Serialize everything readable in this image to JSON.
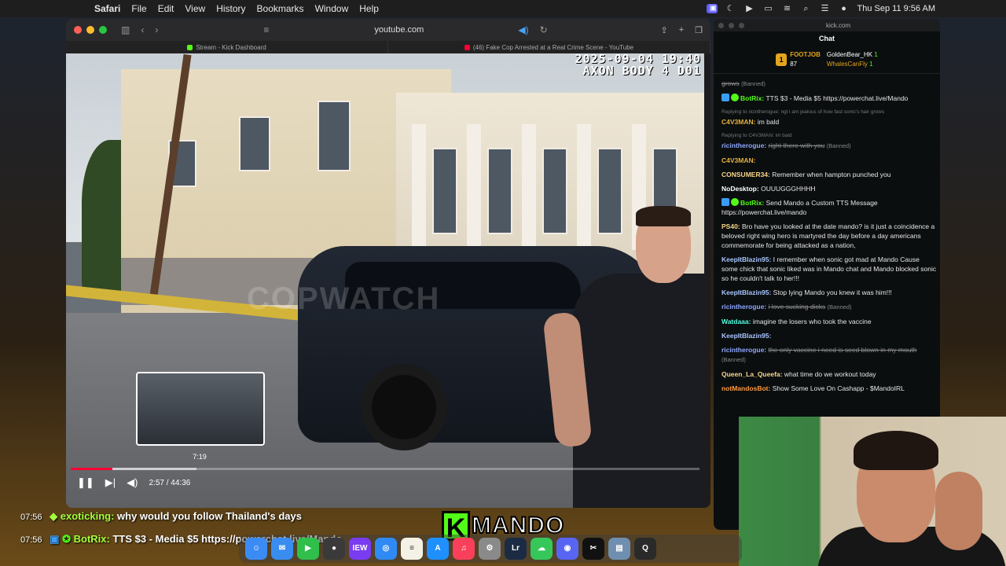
{
  "menubar": {
    "app": "Safari",
    "items": [
      "File",
      "Edit",
      "View",
      "History",
      "Bookmarks",
      "Window",
      "Help"
    ],
    "clock": "Thu Sep 11  9:56 AM"
  },
  "safari": {
    "url": "youtube.com",
    "tabs": [
      {
        "title": "Stream - Kick Dashboard",
        "color": "#53fc18"
      },
      {
        "title": "(46) Fake Cop Arrested at a Real Crime Scene - YouTube",
        "color": "#ff0033"
      }
    ],
    "video": {
      "overlay_line1": "2025-09-04 19:40",
      "overlay_line2": "AXON BODY 4 D01",
      "watermark": "COPWATCH",
      "preview_time": "7:19",
      "time_display": "2:57 / 44:36",
      "progress_fraction": 0.066,
      "loaded_fraction": 0.2
    }
  },
  "kick": {
    "url": "kick.com",
    "title": "Chat",
    "leaderboard": {
      "top_rank": "1",
      "top_user": "FOOTJOB",
      "top_score": "87",
      "second_user": "GoldenBear_HK",
      "second_count": "1",
      "third_user": "WhalesCanFly",
      "third_count": "1"
    },
    "messages": [
      {
        "user": "",
        "text": "grows",
        "tag": "(Banned)",
        "banned": true,
        "color": "#9ab0ff"
      },
      {
        "user": "BotRix:",
        "text": "TTS $3 - Media $5 https://powerchat.live/Mando",
        "color": "#53fc18",
        "bot": true
      },
      {
        "reply": "Replying to ricintherogue: ngl i am jealous of how fast sonic's hair grows",
        "user": "C4V3MAN:",
        "text": "im bald",
        "color": "#e5b13f"
      },
      {
        "reply": "Replying to C4V3MAN: im bald",
        "user": "ricintherogue:",
        "text": "right there with you",
        "tag": "(Banned)",
        "banned": true,
        "color": "#8ea7ff"
      },
      {
        "user": "C4V3MAN:",
        "text": "",
        "color": "#e5b13f"
      },
      {
        "user": "CONSUMER34:",
        "text": "Remember when hampton punched you",
        "color": "#f7d58a"
      },
      {
        "user": "NoDesktop:",
        "text": "OUUUGGGHHHH",
        "color": "#ffffff"
      },
      {
        "user": "BotRix:",
        "text": "Send Mando a Custom TTS Message https://powerchat.live/mando",
        "color": "#53fc18",
        "bot": true
      },
      {
        "user": "PS40:",
        "text": "Bro have you looked at the date mando? is it just a coincidence a beloved right wing hero is martyred the day before a day americans commemorate for being attacked as a nation,",
        "color": "#f7d58a"
      },
      {
        "user": "KeepItBlazin95:",
        "text": "I remember when sonic got mad at Mando Cause some chick that sonic liked was in Mando chat and Mando blocked sonic so he couldn't talk to her!!!",
        "color": "#a7c4ff"
      },
      {
        "user": "KeepItBlazin95:",
        "text": "Stop lying Mando you knew it was him!!!",
        "color": "#a7c4ff"
      },
      {
        "user": "ricintherogue:",
        "text": "i love sucking dicks",
        "tag": "(Banned)",
        "banned": true,
        "color": "#8ea7ff"
      },
      {
        "user": "Watdaaa:",
        "text": "imagine the losers who took the vaccine",
        "color": "#53fce0"
      },
      {
        "user": "KeepItBlazin95:",
        "text": "",
        "color": "#a7c4ff"
      },
      {
        "user": "ricintherogue:",
        "text": "the only vaccine i need is seed blown in my mouth",
        "tag": "(Banned)",
        "banned": true,
        "color": "#8ea7ff"
      },
      {
        "user": "Queen_La_Queefa:",
        "text": "what time do we workout today",
        "color": "#f7d58a"
      },
      {
        "user": "notMandosBot:",
        "text": "Show Some Love On Cashapp - $MandoIRL",
        "color": "#ff9a3d"
      }
    ]
  },
  "overlay": {
    "messages": [
      {
        "time": "07:56",
        "user": "exoticking:",
        "text": "why would you follow Thailand's days"
      },
      {
        "time": "07:56",
        "user": "BotRix:",
        "text": "TTS $3 - Media $5 https://powerchat.live/Mando"
      }
    ],
    "logo_letter": "K",
    "logo_text": "MANDO"
  },
  "dock": {
    "icons": [
      {
        "name": "finder-icon",
        "label": "☺",
        "color": "#3b8bf5"
      },
      {
        "name": "mail-icon",
        "label": "✉",
        "color": "#3a8df0"
      },
      {
        "name": "facetime-icon",
        "label": "▶",
        "color": "#2fbf4a"
      },
      {
        "name": "obs-icon",
        "label": "●",
        "color": "#3a3a3a"
      },
      {
        "name": "iew-icon",
        "label": "IEW",
        "color": "#7a3cf0"
      },
      {
        "name": "safari-icon",
        "label": "◎",
        "color": "#2f8af5"
      },
      {
        "name": "notes-icon",
        "label": "≡",
        "color": "#f4f1e6"
      },
      {
        "name": "app-store-icon",
        "label": "A",
        "color": "#1e90ff"
      },
      {
        "name": "music-icon",
        "label": "♫",
        "color": "#fa3f5a"
      },
      {
        "name": "settings-icon",
        "label": "⚙",
        "color": "#8a8a8a"
      },
      {
        "name": "lightroom-icon",
        "label": "Lr",
        "color": "#1c2b44"
      },
      {
        "name": "messages-icon",
        "label": "☁",
        "color": "#35c759"
      },
      {
        "name": "discord-icon",
        "label": "◉",
        "color": "#5865f2"
      },
      {
        "name": "capcut-icon",
        "label": "✂",
        "color": "#111111"
      },
      {
        "name": "preview-icon",
        "label": "▤",
        "color": "#6f8fb0"
      },
      {
        "name": "quicktime-icon",
        "label": "Q",
        "color": "#2a2a2a"
      }
    ]
  }
}
